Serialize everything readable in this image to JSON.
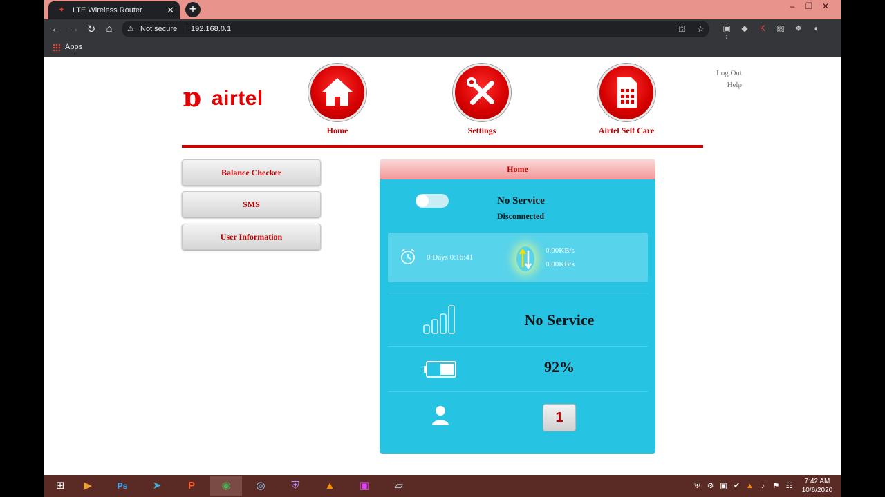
{
  "browser": {
    "tab_title": "LTE Wireless Router",
    "security_label": "Not secure",
    "url": "192.168.0.1",
    "bookmark_apps": "Apps"
  },
  "header": {
    "brand": "airtel",
    "nav": [
      {
        "label": "Home",
        "icon": "home-icon"
      },
      {
        "label": "Settings",
        "icon": "tools-icon"
      },
      {
        "label": "Airtel Self Care",
        "icon": "sim-card-icon"
      }
    ],
    "logout": "Log Out",
    "help": "Help"
  },
  "sidebar": {
    "items": [
      {
        "label": "Balance Checker"
      },
      {
        "label": "SMS"
      },
      {
        "label": "User Information"
      }
    ]
  },
  "panel": {
    "title": "Home",
    "connection_toggle_on": false,
    "network_status": "No Service",
    "connection_status": "Disconnected",
    "uptime": "0 Days 0:16:41",
    "upload_rate": "0.00KB/s",
    "download_rate": "0.00KB/s",
    "signal_text": "No Service",
    "battery_percent": "92%",
    "connected_users": "1"
  },
  "taskbar": {
    "time": "7:42 AM",
    "date": "10/6/2020"
  },
  "colors": {
    "brand_red": "#e40000",
    "panel_blue": "#26c3e3",
    "tab_bar": "#e8948c"
  }
}
